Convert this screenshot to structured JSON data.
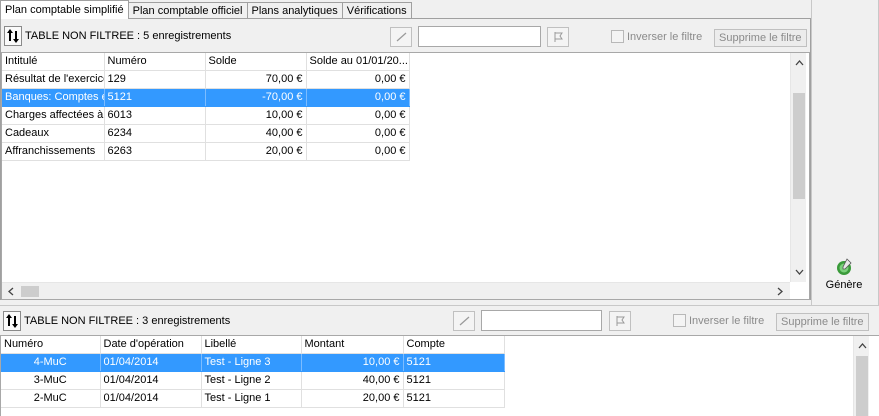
{
  "tabs": [
    "Plan comptable simplifié",
    "Plan comptable officiel",
    "Plans analytiques",
    "Vérifications"
  ],
  "top": {
    "status": "TABLE NON FILTREE : 5 enregistrements",
    "search_value": "",
    "invert_label": "Inverser le filtre",
    "remove_filter_label": "Supprime le filtre",
    "columns": [
      "Intitulé",
      "Numéro",
      "Solde",
      "Solde au 01/01/20..."
    ],
    "rows": [
      {
        "intitule": "Résultat de l'exercice",
        "numero": "129",
        "solde": "70,00 €",
        "solde_init": "0,00 €"
      },
      {
        "intitule": "Banques: Comptes en",
        "numero": "5121",
        "solde": "-70,00 €",
        "solde_init": "0,00 €"
      },
      {
        "intitule": "Charges affectées à",
        "numero": "6013",
        "solde": "10,00 €",
        "solde_init": "0,00 €"
      },
      {
        "intitule": "Cadeaux",
        "numero": "6234",
        "solde": "40,00 €",
        "solde_init": "0,00 €"
      },
      {
        "intitule": "Affranchissements",
        "numero": "6263",
        "solde": "20,00 €",
        "solde_init": "0,00 €"
      }
    ]
  },
  "side": {
    "genere_label": "Génère",
    "genere_icon": "generate-icon"
  },
  "bottom": {
    "status": "TABLE NON FILTREE : 3 enregistrements",
    "search_value": "",
    "invert_label": "Inverser le filtre",
    "remove_filter_label": "Supprime le filtre",
    "columns": [
      "Numéro",
      "Date d'opération",
      "Libellé",
      "Montant",
      "Compte"
    ],
    "rows": [
      {
        "numero": "4-MuC",
        "date": "01/04/2014",
        "libelle": "Test - Ligne 3",
        "montant": "10,00 €",
        "compte": "5121"
      },
      {
        "numero": "3-MuC",
        "date": "01/04/2014",
        "libelle": "Test - Ligne 2",
        "montant": "40,00 €",
        "compte": "5121"
      },
      {
        "numero": "2-MuC",
        "date": "01/04/2014",
        "libelle": "Test - Ligne 1",
        "montant": "20,00 €",
        "compte": "5121"
      }
    ]
  },
  "colors": {
    "selection": "#3399ff"
  }
}
